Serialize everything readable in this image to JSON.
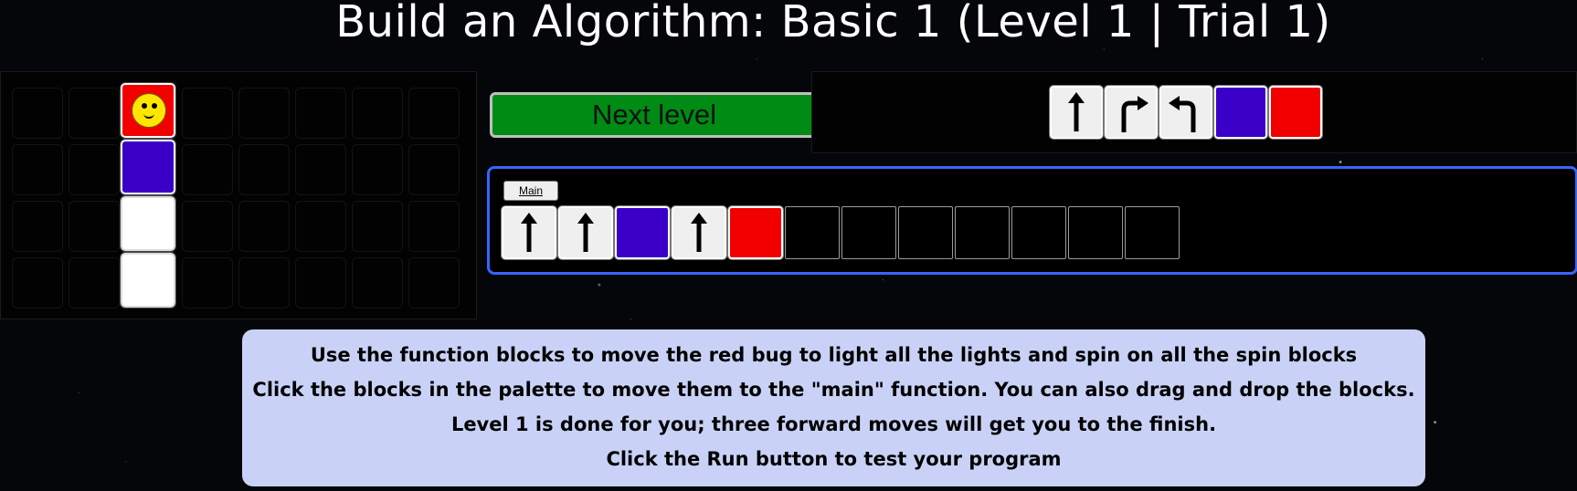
{
  "title": "Build an Algorithm: Basic 1 (Level 1 | Trial 1)",
  "board": {
    "columns": 8,
    "rows": 4,
    "path_tiles": [
      {
        "row": 0,
        "col": 2,
        "type": "red",
        "has_bug": true
      },
      {
        "row": 1,
        "col": 2,
        "type": "blue"
      },
      {
        "row": 2,
        "col": 2,
        "type": "white"
      },
      {
        "row": 3,
        "col": 2,
        "type": "white"
      }
    ]
  },
  "next_level_button": "Next level",
  "palette": {
    "blocks": [
      {
        "type": "command",
        "icon": "forward-arrow-icon"
      },
      {
        "type": "command",
        "icon": "turn-right-arrow-icon"
      },
      {
        "type": "command",
        "icon": "turn-left-arrow-icon"
      },
      {
        "type": "color",
        "color": "#3a00c8",
        "icon": "blue-spin-block"
      },
      {
        "type": "color",
        "color": "#f20000",
        "icon": "red-light-block"
      }
    ]
  },
  "main_function": {
    "tab_label": "Main",
    "slots": [
      {
        "type": "command",
        "icon": "forward-arrow-icon"
      },
      {
        "type": "command",
        "icon": "forward-arrow-icon"
      },
      {
        "type": "color",
        "color": "#3a00c8"
      },
      {
        "type": "command",
        "icon": "forward-arrow-icon"
      },
      {
        "type": "color",
        "color": "#f20000"
      },
      {
        "type": "empty"
      },
      {
        "type": "empty"
      },
      {
        "type": "empty"
      },
      {
        "type": "empty"
      },
      {
        "type": "empty"
      },
      {
        "type": "empty"
      },
      {
        "type": "empty"
      }
    ]
  },
  "instructions": [
    "Use the function blocks to move the red bug to light all the lights and spin on all the spin blocks",
    "Click the blocks in the palette to move them to the \"main\" function. You can also drag and drop the blocks.",
    "Level 1 is done for you; three forward moves will get you to the finish.",
    "Click the Run button to test your program"
  ],
  "colors": {
    "blue_block": "#3a00c8",
    "red_block": "#f20000",
    "next_button": "#008b14",
    "main_border": "#3566ff",
    "instructions_bg": "#c9d2f6"
  }
}
